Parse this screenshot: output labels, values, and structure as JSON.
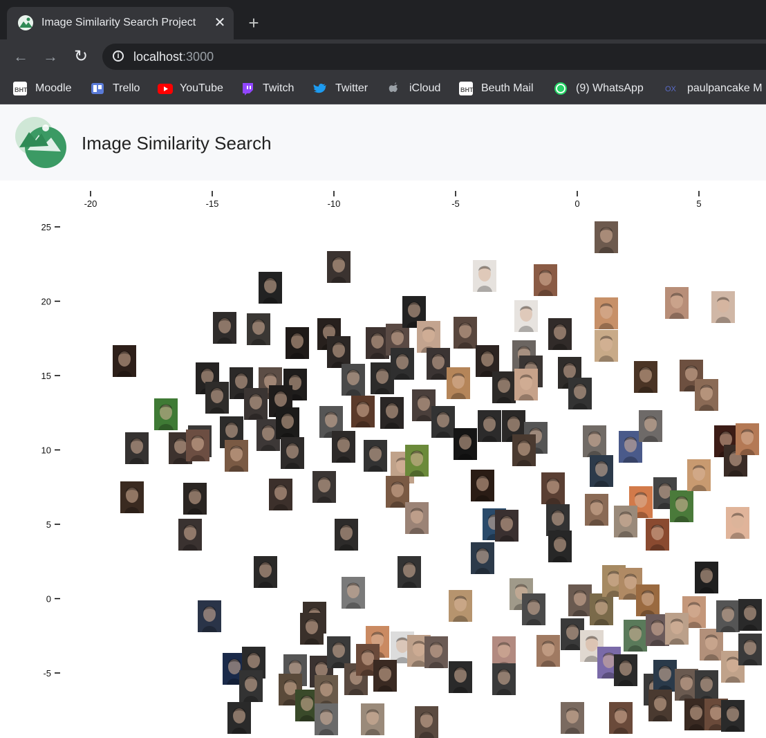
{
  "browser": {
    "tab_title": "Image Similarity Search Project",
    "tab_close": "✕",
    "new_tab": "+",
    "back": "←",
    "forward": "→",
    "reload": "↻",
    "url_host": "localhost",
    "url_port": ":3000",
    "info": "i"
  },
  "bookmarks": [
    {
      "label": "Moodle",
      "icon": "bht-icon",
      "color": "#ffffff"
    },
    {
      "label": "Trello",
      "icon": "trello-icon",
      "color": "#5a7bd8"
    },
    {
      "label": "YouTube",
      "icon": "youtube-icon",
      "color": "#ff0000"
    },
    {
      "label": "Twitch",
      "icon": "twitch-icon",
      "color": "#9146ff"
    },
    {
      "label": "Twitter",
      "icon": "twitter-icon",
      "color": "#1d9bf0"
    },
    {
      "label": "iCloud",
      "icon": "apple-icon",
      "color": "#9aa0a6"
    },
    {
      "label": "Beuth Mail",
      "icon": "bht-icon",
      "color": "#ffffff"
    },
    {
      "label": "(9) WhatsApp",
      "icon": "whatsapp-icon",
      "color": "#25d366"
    },
    {
      "label": "paulpancake M",
      "icon": "ox-icon",
      "color": "#5a6bc8"
    }
  ],
  "app": {
    "title": "Image Similarity Search",
    "accent": "#2f8a55"
  },
  "chart_data": {
    "type": "scatter",
    "title": "",
    "xlabel": "",
    "ylabel": "",
    "x_ticks": [
      -20,
      -15,
      -10,
      -5,
      0,
      5
    ],
    "y_ticks": [
      25,
      20,
      15,
      10,
      5,
      0,
      -5
    ],
    "xlim": [
      -20,
      6
    ],
    "ylim": [
      -8,
      25
    ],
    "marker": "face-photo-thumbnail",
    "points": [
      {
        "x": 1.2,
        "y": 24.3,
        "tone": "#6d5a4e"
      },
      {
        "x": -9.8,
        "y": 22.3,
        "tone": "#3b3330"
      },
      {
        "x": -12.6,
        "y": 20.9,
        "tone": "#222"
      },
      {
        "x": -3.8,
        "y": 21.7,
        "tone": "#e6e2de"
      },
      {
        "x": -1.3,
        "y": 21.4,
        "tone": "#8a5b45"
      },
      {
        "x": 1.2,
        "y": 19.2,
        "tone": "#c79068"
      },
      {
        "x": 4.1,
        "y": 19.9,
        "tone": "#b88e78"
      },
      {
        "x": 6.0,
        "y": 19.6,
        "tone": "#d0b7a6"
      },
      {
        "x": -14.5,
        "y": 18.2,
        "tone": "#2f2c2b"
      },
      {
        "x": -13.1,
        "y": 18.1,
        "tone": "#3a3734"
      },
      {
        "x": -11.5,
        "y": 17.2,
        "tone": "#1f1a18"
      },
      {
        "x": -10.2,
        "y": 17.8,
        "tone": "#27201d"
      },
      {
        "x": -9.8,
        "y": 16.6,
        "tone": "#2c2725"
      },
      {
        "x": -8.2,
        "y": 17.2,
        "tone": "#3e3330"
      },
      {
        "x": -7.4,
        "y": 17.4,
        "tone": "#5a4a44"
      },
      {
        "x": -6.7,
        "y": 19.3,
        "tone": "#222"
      },
      {
        "x": -6.1,
        "y": 17.6,
        "tone": "#c3a48f"
      },
      {
        "x": -4.6,
        "y": 17.9,
        "tone": "#58463d"
      },
      {
        "x": -3.7,
        "y": 16.0,
        "tone": "#2c2421"
      },
      {
        "x": -2.1,
        "y": 19.0,
        "tone": "#e7e3df"
      },
      {
        "x": -0.7,
        "y": 17.8,
        "tone": "#312b29"
      },
      {
        "x": -2.2,
        "y": 16.3,
        "tone": "#6b6561"
      },
      {
        "x": 1.2,
        "y": 17.0,
        "tone": "#c8aa88"
      },
      {
        "x": -18.6,
        "y": 16.0,
        "tone": "#2d1f19"
      },
      {
        "x": -15.2,
        "y": 14.8,
        "tone": "#252322"
      },
      {
        "x": -13.8,
        "y": 14.5,
        "tone": "#2b2928"
      },
      {
        "x": -12.6,
        "y": 14.5,
        "tone": "#5c4d45"
      },
      {
        "x": -11.6,
        "y": 14.4,
        "tone": "#1f1d1c"
      },
      {
        "x": -14.8,
        "y": 13.5,
        "tone": "#2e2c2a"
      },
      {
        "x": -13.2,
        "y": 13.1,
        "tone": "#3b3533"
      },
      {
        "x": -12.2,
        "y": 13.3,
        "tone": "#1f1c1b"
      },
      {
        "x": -9.2,
        "y": 14.7,
        "tone": "#4a4a4a"
      },
      {
        "x": -8.0,
        "y": 14.8,
        "tone": "#2c2b2a"
      },
      {
        "x": -7.2,
        "y": 15.8,
        "tone": "#2f2f2f"
      },
      {
        "x": -5.7,
        "y": 15.8,
        "tone": "#3b3433"
      },
      {
        "x": -4.9,
        "y": 14.5,
        "tone": "#b58559"
      },
      {
        "x": -3.0,
        "y": 14.2,
        "tone": "#2d2a28"
      },
      {
        "x": -1.9,
        "y": 15.3,
        "tone": "#3a3533"
      },
      {
        "x": -0.3,
        "y": 15.2,
        "tone": "#2f2c2a"
      },
      {
        "x": 0.1,
        "y": 13.8,
        "tone": "#333"
      },
      {
        "x": -2.1,
        "y": 14.4,
        "tone": "#c6a28a"
      },
      {
        "x": 2.8,
        "y": 14.9,
        "tone": "#4a3425"
      },
      {
        "x": 4.7,
        "y": 15.0,
        "tone": "#6d5040"
      },
      {
        "x": 5.3,
        "y": 13.7,
        "tone": "#8a6a55"
      },
      {
        "x": -16.9,
        "y": 12.4,
        "tone": "#3f7a35"
      },
      {
        "x": -15.5,
        "y": 10.6,
        "tone": "#3a3837"
      },
      {
        "x": -14.2,
        "y": 11.2,
        "tone": "#2c2b2a"
      },
      {
        "x": -12.7,
        "y": 11.0,
        "tone": "#3d3837"
      },
      {
        "x": -11.9,
        "y": 11.8,
        "tone": "#1c1b1a"
      },
      {
        "x": -10.1,
        "y": 11.9,
        "tone": "#555"
      },
      {
        "x": -8.8,
        "y": 12.6,
        "tone": "#5b3a2a"
      },
      {
        "x": -7.6,
        "y": 12.5,
        "tone": "#2a2625"
      },
      {
        "x": -6.3,
        "y": 13.0,
        "tone": "#4a3f3b"
      },
      {
        "x": -5.5,
        "y": 11.9,
        "tone": "#333"
      },
      {
        "x": -3.6,
        "y": 11.6,
        "tone": "#2c2b2b"
      },
      {
        "x": -2.6,
        "y": 11.6,
        "tone": "#2a2827"
      },
      {
        "x": -1.7,
        "y": 10.8,
        "tone": "#555"
      },
      {
        "x": 0.7,
        "y": 10.6,
        "tone": "#716b66"
      },
      {
        "x": 2.2,
        "y": 10.2,
        "tone": "#4a5a8a"
      },
      {
        "x": 3.0,
        "y": 11.6,
        "tone": "#6e6a68"
      },
      {
        "x": -18.1,
        "y": 10.1,
        "tone": "#353231"
      },
      {
        "x": -16.3,
        "y": 10.1,
        "tone": "#3d322e"
      },
      {
        "x": -15.6,
        "y": 10.3,
        "tone": "#6c4e42"
      },
      {
        "x": -14.0,
        "y": 9.6,
        "tone": "#7a5a44"
      },
      {
        "x": -11.7,
        "y": 9.8,
        "tone": "#2e2b2a"
      },
      {
        "x": -9.6,
        "y": 10.2,
        "tone": "#2d2a29"
      },
      {
        "x": -8.3,
        "y": 9.6,
        "tone": "#333"
      },
      {
        "x": -7.2,
        "y": 8.8,
        "tone": "#c0a28a"
      },
      {
        "x": -6.6,
        "y": 9.3,
        "tone": "#6b8a3a"
      },
      {
        "x": -4.6,
        "y": 10.4,
        "tone": "#151515"
      },
      {
        "x": -2.2,
        "y": 10.0,
        "tone": "#4a3a30"
      },
      {
        "x": -3.9,
        "y": 7.6,
        "tone": "#2a1c15"
      },
      {
        "x": -1.0,
        "y": 7.4,
        "tone": "#5a3f33"
      },
      {
        "x": 1.0,
        "y": 8.6,
        "tone": "#2c3a4a"
      },
      {
        "x": 2.6,
        "y": 6.5,
        "tone": "#d27a4a"
      },
      {
        "x": 3.6,
        "y": 7.1,
        "tone": "#444"
      },
      {
        "x": 4.3,
        "y": 6.2,
        "tone": "#4a7a3a"
      },
      {
        "x": 5.0,
        "y": 8.3,
        "tone": "#c89a70"
      },
      {
        "x": 6.1,
        "y": 10.6,
        "tone": "#3c1c16"
      },
      {
        "x": 6.5,
        "y": 9.3,
        "tone": "#3a2c26"
      },
      {
        "x": 7.0,
        "y": 10.7,
        "tone": "#b47955"
      },
      {
        "x": -18.3,
        "y": 6.8,
        "tone": "#3a2a20"
      },
      {
        "x": -15.7,
        "y": 6.7,
        "tone": "#2a2522"
      },
      {
        "x": -12.2,
        "y": 7.0,
        "tone": "#3c302b"
      },
      {
        "x": -10.4,
        "y": 7.5,
        "tone": "#3a3533"
      },
      {
        "x": -7.4,
        "y": 7.2,
        "tone": "#7a5a44"
      },
      {
        "x": -6.6,
        "y": 5.4,
        "tone": "#9b8376"
      },
      {
        "x": -3.4,
        "y": 5.0,
        "tone": "#2a4a6a"
      },
      {
        "x": -2.9,
        "y": 4.9,
        "tone": "#3a3030"
      },
      {
        "x": -0.8,
        "y": 5.3,
        "tone": "#333"
      },
      {
        "x": -0.7,
        "y": 3.5,
        "tone": "#272727"
      },
      {
        "x": 0.8,
        "y": 6.0,
        "tone": "#8a6a55"
      },
      {
        "x": 2.0,
        "y": 5.2,
        "tone": "#9a8a7a"
      },
      {
        "x": 3.3,
        "y": 4.3,
        "tone": "#8a4a30"
      },
      {
        "x": 6.6,
        "y": 5.1,
        "tone": "#e0b49a"
      },
      {
        "x": -15.9,
        "y": 4.3,
        "tone": "#3a3230"
      },
      {
        "x": -9.5,
        "y": 4.3,
        "tone": "#2d2b2a"
      },
      {
        "x": -3.9,
        "y": 2.7,
        "tone": "#2c3a4a"
      },
      {
        "x": -12.8,
        "y": 1.8,
        "tone": "#2a2928"
      },
      {
        "x": -6.9,
        "y": 1.8,
        "tone": "#333"
      },
      {
        "x": -9.2,
        "y": 0.4,
        "tone": "#7a7a7a"
      },
      {
        "x": -4.8,
        "y": -0.5,
        "tone": "#b6946e"
      },
      {
        "x": -2.3,
        "y": 0.3,
        "tone": "#a09a8a"
      },
      {
        "x": -1.8,
        "y": -0.7,
        "tone": "#4a4a4a"
      },
      {
        "x": 0.1,
        "y": -0.1,
        "tone": "#6a5a50"
      },
      {
        "x": 1.0,
        "y": -0.7,
        "tone": "#7a6a4a"
      },
      {
        "x": 1.5,
        "y": 1.2,
        "tone": "#a68a62"
      },
      {
        "x": 2.2,
        "y": 1.0,
        "tone": "#b08a64"
      },
      {
        "x": 2.9,
        "y": -0.1,
        "tone": "#9a6a40"
      },
      {
        "x": 5.3,
        "y": 1.4,
        "tone": "#1f1f1f"
      },
      {
        "x": 4.8,
        "y": -0.9,
        "tone": "#c4977a"
      },
      {
        "x": -15.1,
        "y": -1.2,
        "tone": "#2a3448"
      },
      {
        "x": -10.8,
        "y": -1.3,
        "tone": "#3a302a"
      },
      {
        "x": -10.9,
        "y": -2.0,
        "tone": "#3a302a"
      },
      {
        "x": -8.2,
        "y": -2.9,
        "tone": "#ca8a62"
      },
      {
        "x": -7.2,
        "y": -3.3,
        "tone": "#dcdcdc"
      },
      {
        "x": -6.5,
        "y": -3.5,
        "tone": "#bda08a"
      },
      {
        "x": -5.8,
        "y": -3.6,
        "tone": "#6a5a54"
      },
      {
        "x": -3.0,
        "y": -3.6,
        "tone": "#b28a80"
      },
      {
        "x": -1.2,
        "y": -3.5,
        "tone": "#a07a62"
      },
      {
        "x": -0.2,
        "y": -2.4,
        "tone": "#3a3a3a"
      },
      {
        "x": 0.6,
        "y": -3.2,
        "tone": "#e0d8d0"
      },
      {
        "x": 1.3,
        "y": -4.3,
        "tone": "#7a6aa8"
      },
      {
        "x": 2.4,
        "y": -2.5,
        "tone": "#5a7a5a"
      },
      {
        "x": 3.3,
        "y": -2.1,
        "tone": "#6a5a5a"
      },
      {
        "x": 4.1,
        "y": -2.0,
        "tone": "#bba08a"
      },
      {
        "x": 5.5,
        "y": -3.1,
        "tone": "#b2907a"
      },
      {
        "x": 6.2,
        "y": -1.2,
        "tone": "#555"
      },
      {
        "x": 7.1,
        "y": -1.1,
        "tone": "#2a2a2a"
      },
      {
        "x": 6.4,
        "y": -4.6,
        "tone": "#c0a28a"
      },
      {
        "x": 7.1,
        "y": -3.4,
        "tone": "#3a3a3a"
      },
      {
        "x": -14.1,
        "y": -4.7,
        "tone": "#1a2a4a"
      },
      {
        "x": -13.3,
        "y": -4.3,
        "tone": "#2a2a2a"
      },
      {
        "x": -13.4,
        "y": -5.9,
        "tone": "#333"
      },
      {
        "x": -11.6,
        "y": -4.8,
        "tone": "#555"
      },
      {
        "x": -10.5,
        "y": -4.9,
        "tone": "#3a3230"
      },
      {
        "x": -9.8,
        "y": -3.6,
        "tone": "#3a3a3a"
      },
      {
        "x": -9.1,
        "y": -5.4,
        "tone": "#5a4a40"
      },
      {
        "x": -8.6,
        "y": -4.1,
        "tone": "#6a4a3a"
      },
      {
        "x": -7.9,
        "y": -5.2,
        "tone": "#3a2a22"
      },
      {
        "x": -4.8,
        "y": -5.3,
        "tone": "#2a2a2a"
      },
      {
        "x": -3.0,
        "y": -5.4,
        "tone": "#3a3a3a"
      },
      {
        "x": -11.8,
        "y": -6.1,
        "tone": "#5a4a3a"
      },
      {
        "x": -11.1,
        "y": -7.2,
        "tone": "#3a4a2a"
      },
      {
        "x": -10.3,
        "y": -6.2,
        "tone": "#6a5a4a"
      },
      {
        "x": -10.3,
        "y": -8.1,
        "tone": "#6a6a6a"
      },
      {
        "x": -13.9,
        "y": -8.0,
        "tone": "#2a2a2a"
      },
      {
        "x": -8.4,
        "y": -8.1,
        "tone": "#9a8a7a"
      },
      {
        "x": -6.2,
        "y": -8.3,
        "tone": "#5a4a40"
      },
      {
        "x": 2.0,
        "y": -4.8,
        "tone": "#2a2a2a"
      },
      {
        "x": 3.2,
        "y": -6.1,
        "tone": "#3a3a3a"
      },
      {
        "x": 3.6,
        "y": -5.2,
        "tone": "#2a3a4a"
      },
      {
        "x": 4.5,
        "y": -5.8,
        "tone": "#6a5a50"
      },
      {
        "x": 5.3,
        "y": -5.9,
        "tone": "#3a3a3a"
      },
      {
        "x": 3.4,
        "y": -7.2,
        "tone": "#4a3a30"
      },
      {
        "x": 4.9,
        "y": -7.8,
        "tone": "#3a2a22"
      },
      {
        "x": 5.7,
        "y": -7.8,
        "tone": "#6a4a3a"
      },
      {
        "x": 6.4,
        "y": -7.9,
        "tone": "#2a2a2a"
      },
      {
        "x": 1.8,
        "y": -8.0,
        "tone": "#6a4a3a"
      },
      {
        "x": -0.2,
        "y": -8.0,
        "tone": "#7a6a60"
      }
    ]
  }
}
